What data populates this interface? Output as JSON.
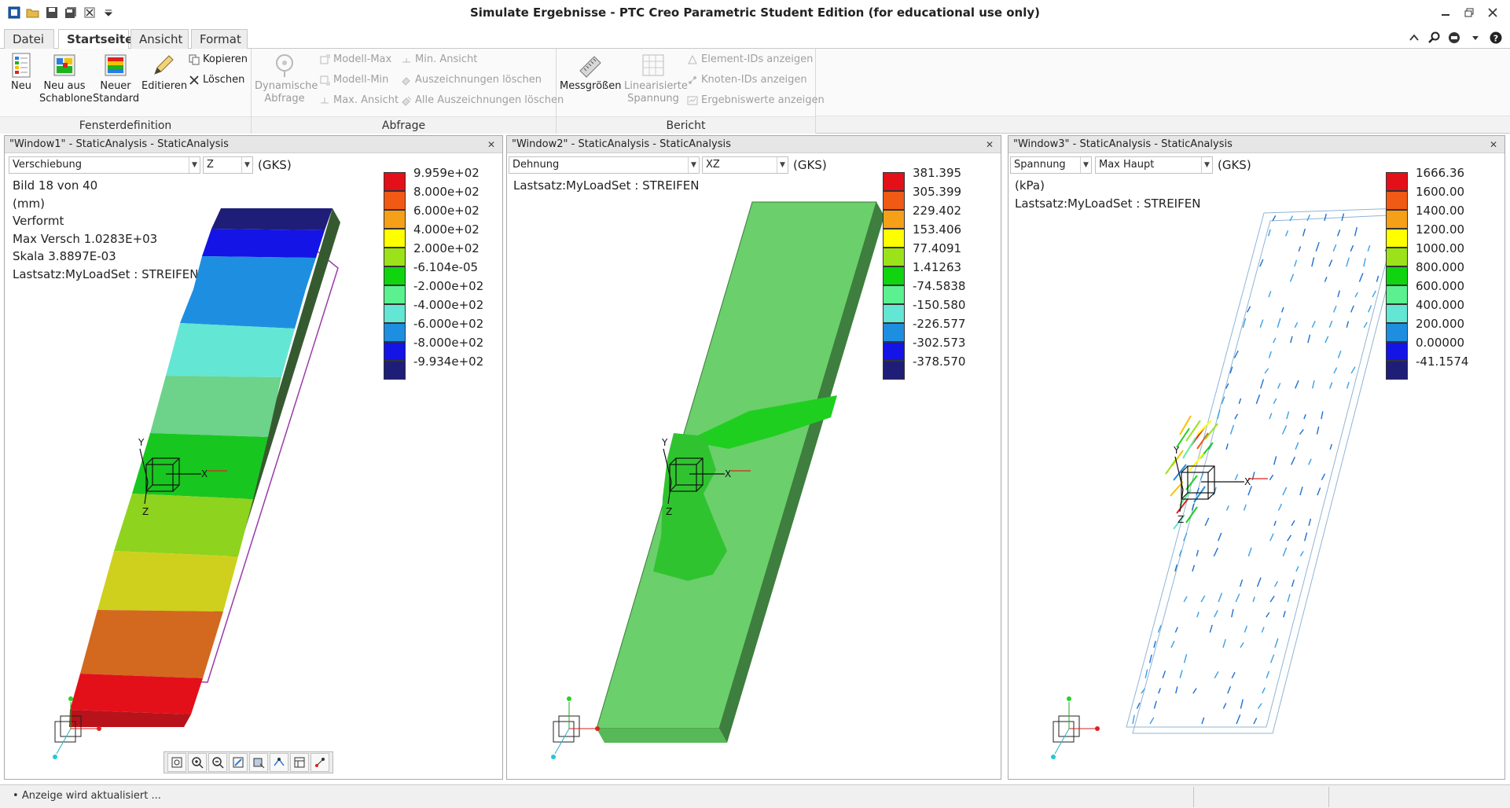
{
  "app": {
    "title": "Simulate Ergebnisse - PTC Creo Parametric Student Edition (for educational use only)"
  },
  "tabs": {
    "datei": "Datei",
    "startseite": "Startseite",
    "ansicht": "Ansicht",
    "format": "Format"
  },
  "ribbon": {
    "fensterdefinition": {
      "label": "Fensterdefinition",
      "neu": "Neu",
      "neu_aus_schablone_1": "Neu aus",
      "neu_aus_schablone_2": "Schablone",
      "neuer_standard_1": "Neuer",
      "neuer_standard_2": "Standard",
      "editieren": "Editieren",
      "kopieren": "Kopieren",
      "loeschen": "Löschen"
    },
    "abfrage": {
      "label": "Abfrage",
      "dynamische_1": "Dynamische",
      "dynamische_2": "Abfrage",
      "modell_max": "Modell-Max",
      "modell_min": "Modell-Min",
      "max_ansicht": "Max. Ansicht",
      "min_ansicht": "Min. Ansicht",
      "auszeichnungen_loeschen": "Auszeichnungen löschen",
      "alle_auszeichnungen_loeschen": "Alle Auszeichnungen löschen"
    },
    "bericht": {
      "label": "Bericht",
      "messgroessen": "Messgrößen",
      "linearisierte_1": "Linearisierte",
      "linearisierte_2": "Spannung",
      "element_ids": "Element-IDs anzeigen",
      "knoten_ids": "Knoten-IDs anzeigen",
      "ergebniswerte": "Ergebniswerte anzeigen"
    }
  },
  "windows": [
    {
      "title": "\"Window1\" - StaticAnalysis - StaticAnalysis",
      "quantity": "Verschiebung",
      "component": "Z",
      "csys": "(GKS)",
      "info": [
        "Bild 18 von 40",
        "(mm)",
        "Verformt",
        "Max Versch  1.0283E+03",
        "Skala  3.8897E-03",
        "Lastsatz:MyLoadSet :   STREIFEN"
      ],
      "legend_colors": [
        "#e3101a",
        "#f05a14",
        "#f5a017",
        "#ffff00",
        "#9be21b",
        "#0fd40f",
        "#5bf090",
        "#63e6d3",
        "#1e8fe0",
        "#1414e6",
        "#1e1e78"
      ],
      "legend_values": [
        "9.959e+02",
        "8.000e+02",
        "6.000e+02",
        "4.000e+02",
        "2.000e+02",
        "-6.104e-05",
        "-2.000e+02",
        "-4.000e+02",
        "-6.000e+02",
        "-8.000e+02",
        "-9.934e+02"
      ]
    },
    {
      "title": "\"Window2\" - StaticAnalysis - StaticAnalysis",
      "quantity": "Dehnung",
      "component": "XZ",
      "csys": "(GKS)",
      "info": [
        "Lastsatz:MyLoadSet :   STREIFEN"
      ],
      "legend_colors": [
        "#e3101a",
        "#f05a14",
        "#f5a017",
        "#ffff00",
        "#9be21b",
        "#0fd40f",
        "#5bf090",
        "#63e6d3",
        "#1e8fe0",
        "#1414e6",
        "#1e1e78"
      ],
      "legend_values": [
        "381.395",
        "305.399",
        "229.402",
        "153.406",
        "77.4091",
        "1.41263",
        "-74.5838",
        "-150.580",
        "-226.577",
        "-302.573",
        "-378.570"
      ]
    },
    {
      "title": "\"Window3\" - StaticAnalysis - StaticAnalysis",
      "quantity": "Spannung",
      "component": "Max Haupt",
      "csys": "(GKS)",
      "info": [
        "(kPa)",
        "Lastsatz:MyLoadSet :   STREIFEN"
      ],
      "legend_colors": [
        "#e3101a",
        "#f05a14",
        "#f5a017",
        "#ffff00",
        "#9be21b",
        "#0fd40f",
        "#5bf090",
        "#63e6d3",
        "#1e8fe0",
        "#1414e6",
        "#1e1e78"
      ],
      "legend_values": [
        "1666.36",
        "1600.00",
        "1400.00",
        "1200.00",
        "1000.00",
        "800.000",
        "600.000",
        "400.000",
        "200.000",
        "0.00000",
        "-41.1574"
      ]
    }
  ],
  "axes": {
    "x": "X",
    "y": "Y",
    "z": "Z"
  },
  "status": {
    "text": "Anzeige wird aktualisiert ..."
  }
}
